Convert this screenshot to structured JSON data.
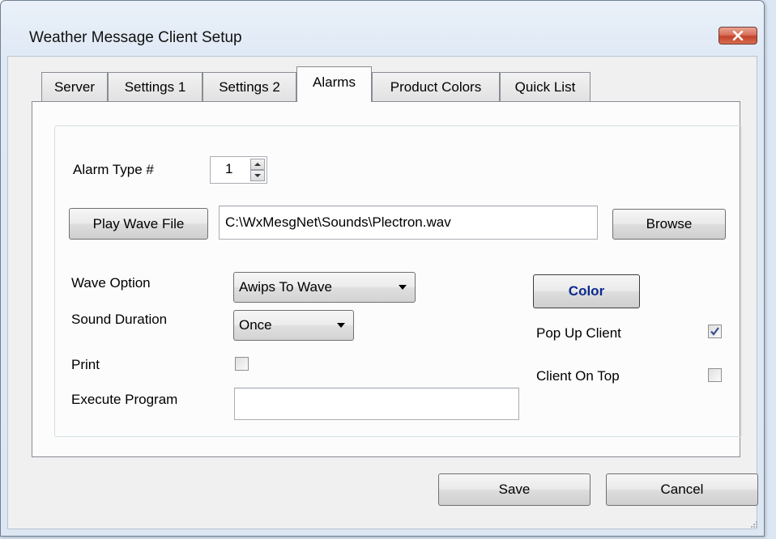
{
  "window": {
    "title": "Weather Message Client Setup"
  },
  "tabs": [
    {
      "label": "Server",
      "active": false
    },
    {
      "label": "Settings 1",
      "active": false
    },
    {
      "label": "Settings 2",
      "active": false
    },
    {
      "label": "Alarms",
      "active": true
    },
    {
      "label": "Product Colors",
      "active": false
    },
    {
      "label": "Quick List",
      "active": false
    }
  ],
  "alarms": {
    "alarm_type_label": "Alarm Type #",
    "alarm_type_value": "1",
    "play_wave_button": "Play Wave File",
    "wave_file_path": "C:\\WxMesgNet\\Sounds\\Plectron.wav",
    "browse_button": "Browse",
    "wave_option_label": "Wave Option",
    "wave_option_value": "Awips To Wave",
    "sound_duration_label": "Sound Duration",
    "sound_duration_value": "Once",
    "print_label": "Print",
    "print_checked": false,
    "execute_program_label": "Execute Program",
    "execute_program_value": "",
    "color_button": "Color",
    "color_button_text_color": "#0b2a8c",
    "popup_client_label": "Pop  Up Client",
    "popup_client_checked": true,
    "client_on_top_label": "Client On Top",
    "client_on_top_checked": false
  },
  "footer": {
    "save_button": "Save",
    "cancel_button": "Cancel"
  },
  "colors": {
    "close_button": "#c8452d",
    "window_frame": "#dce7f3",
    "checkmark": "#3a4e8c"
  }
}
